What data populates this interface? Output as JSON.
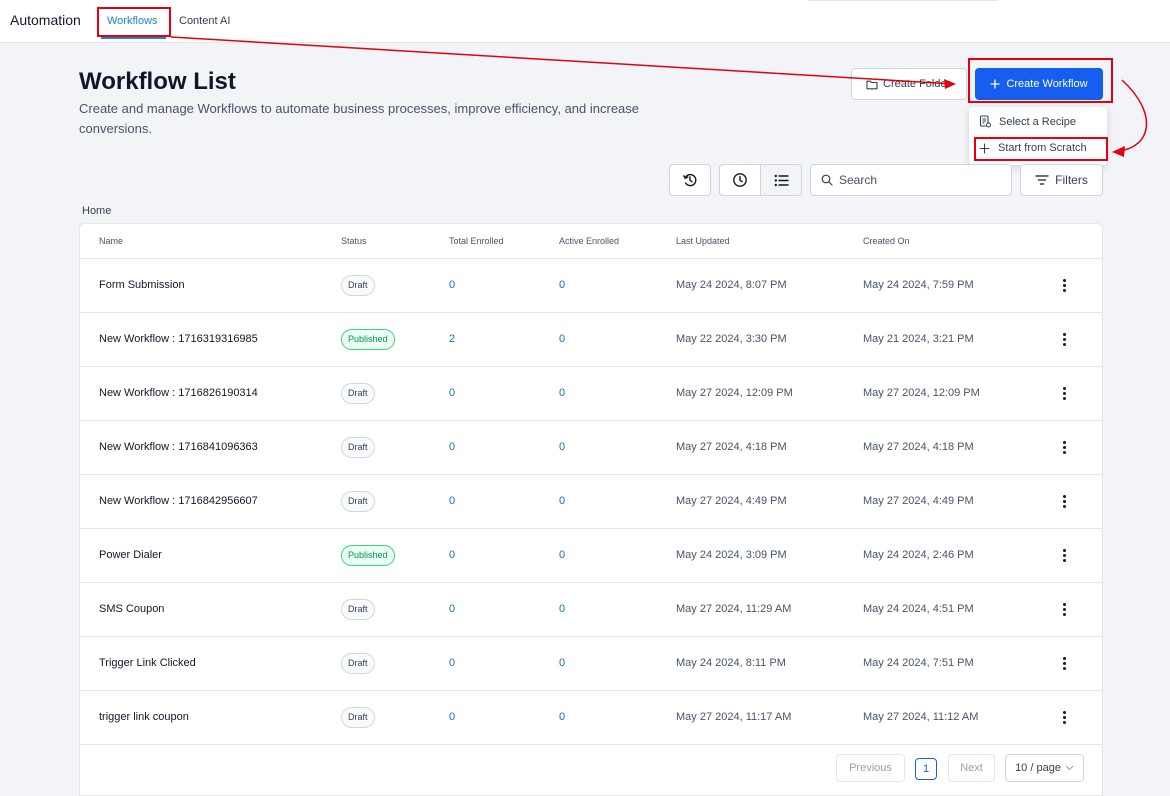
{
  "topbar": {
    "app_title": "Automation",
    "tabs": [
      {
        "label": "Workflows",
        "active": true
      },
      {
        "label": "Content AI",
        "active": false
      }
    ]
  },
  "header": {
    "title": "Workflow List",
    "description": "Create and manage Workflows to automate business processes, improve efficiency, and increase conversions.",
    "create_folder_label": "Create Folder",
    "create_workflow_label": "Create Workflow"
  },
  "dropdown": {
    "items": [
      {
        "label": "Select a Recipe",
        "icon": "recipe-icon"
      },
      {
        "label": "Start from Scratch",
        "icon": "plus-icon"
      }
    ]
  },
  "toolbar": {
    "search_placeholder": "Search",
    "filters_label": "Filters"
  },
  "breadcrumb": "Home",
  "table": {
    "columns": [
      "Name",
      "Status",
      "Total Enrolled",
      "Active Enrolled",
      "Last Updated",
      "Created On"
    ],
    "rows": [
      {
        "name": "Form Submission",
        "status": "Draft",
        "total": "0",
        "active": "0",
        "updated": "May 24 2024, 8:07 PM",
        "created": "May 24 2024, 7:59 PM"
      },
      {
        "name": "New Workflow : 1716319316985",
        "status": "Published",
        "total": "2",
        "active": "0",
        "updated": "May 22 2024, 3:30 PM",
        "created": "May 21 2024, 3:21 PM"
      },
      {
        "name": "New Workflow : 1716826190314",
        "status": "Draft",
        "total": "0",
        "active": "0",
        "updated": "May 27 2024, 12:09 PM",
        "created": "May 27 2024, 12:09 PM"
      },
      {
        "name": "New Workflow : 1716841096363",
        "status": "Draft",
        "total": "0",
        "active": "0",
        "updated": "May 27 2024, 4:18 PM",
        "created": "May 27 2024, 4:18 PM"
      },
      {
        "name": "New Workflow : 1716842956607",
        "status": "Draft",
        "total": "0",
        "active": "0",
        "updated": "May 27 2024, 4:49 PM",
        "created": "May 27 2024, 4:49 PM"
      },
      {
        "name": "Power Dialer",
        "status": "Published",
        "total": "0",
        "active": "0",
        "updated": "May 24 2024, 3:09 PM",
        "created": "May 24 2024, 2:46 PM"
      },
      {
        "name": "SMS Coupon",
        "status": "Draft",
        "total": "0",
        "active": "0",
        "updated": "May 27 2024, 11:29 AM",
        "created": "May 24 2024, 4:51 PM"
      },
      {
        "name": "Trigger Link Clicked",
        "status": "Draft",
        "total": "0",
        "active": "0",
        "updated": "May 24 2024, 8:11 PM",
        "created": "May 24 2024, 7:51 PM"
      },
      {
        "name": "trigger link coupon",
        "status": "Draft",
        "total": "0",
        "active": "0",
        "updated": "May 27 2024, 11:17 AM",
        "created": "May 27 2024, 11:12 AM"
      }
    ]
  },
  "pagination": {
    "previous_label": "Previous",
    "current_page": "1",
    "next_label": "Next",
    "page_size_label": "10 / page"
  },
  "colors": {
    "primary": "#155eef",
    "annotation": "#e3000f",
    "link": "#1b6fa8",
    "published": "#039855"
  }
}
